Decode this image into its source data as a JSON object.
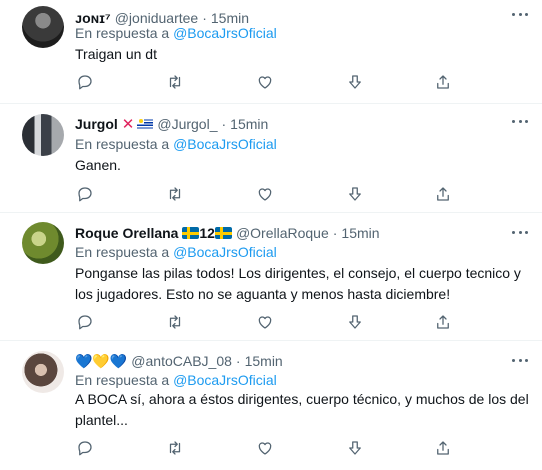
{
  "tweets": [
    {
      "display_name": "ᴊᴏɴɪ⁷",
      "handle": "@joniduartee",
      "dot": "·",
      "time": "15min",
      "reply_prefix": "En respuesta a",
      "reply_to": "@BocaJrsOficial",
      "text": "Traigan un dt"
    },
    {
      "display_name": "Jurgol",
      "handle": "@Jurgol_",
      "dot": "·",
      "time": "15min",
      "reply_prefix": "En respuesta a",
      "reply_to": "@BocaJrsOficial",
      "text": "Ganen."
    },
    {
      "display_name": "Roque Orellana",
      "name_number": "12",
      "handle": "@OrellaRoque",
      "dot": "·",
      "time": "15min",
      "reply_prefix": "En respuesta a",
      "reply_to": "@BocaJrsOficial",
      "text": "Ponganse las pilas todos! Los dirigentes, el consejo, el cuerpo tecnico y los jugadores. Esto no se aguanta y menos hasta diciembre!"
    },
    {
      "display_name": "💙💛💙",
      "handle": "@antoCABJ_08",
      "dot": "·",
      "time": "15min",
      "reply_prefix": "En respuesta a",
      "reply_to": "@BocaJrsOficial",
      "text": "A BOCA sí, ahora a  éstos dirigentes, cuerpo técnico, y muchos de los del plantel..."
    }
  ],
  "icons": [
    "reply-icon",
    "retweet-icon",
    "like-icon",
    "downvote-icon",
    "share-icon",
    "more-icon"
  ],
  "colors": {
    "link": "#1d9bf0",
    "secondary": "#536471",
    "text": "#0f1419",
    "divider": "#eff3f4"
  }
}
